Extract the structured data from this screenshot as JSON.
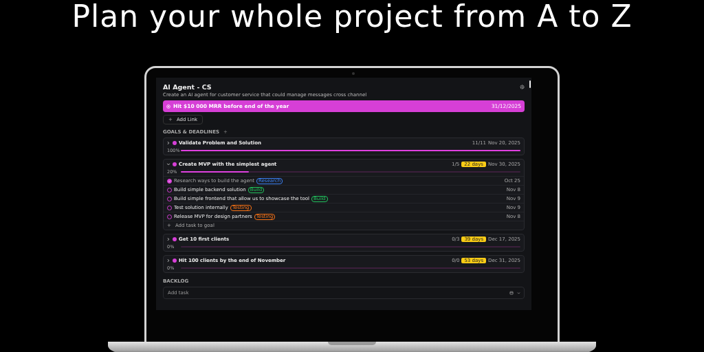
{
  "headline": "Plan your whole project from A to Z",
  "project": {
    "title": "AI Agent - CS",
    "description": "Create an AI agent for customer service that could manage messages cross channel"
  },
  "main_goal": {
    "title": "Hit $10 000 MRR before end of the year",
    "date": "31/12/2025"
  },
  "add_link": {
    "icon": "+",
    "label": "Add Link"
  },
  "goals_section": {
    "title": "GOALS & DEADLINES",
    "add_icon": "+"
  },
  "goals": [
    {
      "title": "Validate Problem and Solution",
      "expanded": false,
      "percent": "100%",
      "level": 1,
      "count": "11/11",
      "date": "Nov 20, 2025"
    },
    {
      "title": "Create MVP with the simplest agent",
      "expanded": true,
      "percent": "20%",
      "level": 0.2,
      "count": "1/5",
      "badge": "22 days",
      "date": "Nov 30, 2025",
      "tasks": [
        {
          "title": "Research ways to build the agent",
          "done": true,
          "tag": {
            "label": "Research",
            "color": "#3b82f6"
          },
          "date": "Oct 25"
        },
        {
          "title": "Build simple backend solution",
          "done": false,
          "tag": {
            "label": "Build",
            "color": "#22c55e"
          },
          "date": "Nov 8"
        },
        {
          "title": "Build simple frontend that allow us to showcase the tool",
          "done": false,
          "tag": {
            "label": "Build",
            "color": "#22c55e"
          },
          "date": "Nov 9"
        },
        {
          "title": "Test solution internally",
          "done": false,
          "tag": {
            "label": "Testing",
            "color": "#f97316"
          },
          "date": "Nov 9"
        },
        {
          "title": "Release MVP for design partners",
          "done": false,
          "tag": {
            "label": "Testing",
            "color": "#f97316"
          },
          "date": "Nov 8"
        }
      ],
      "add_task": {
        "icon": "+",
        "label": "Add task to goal"
      }
    },
    {
      "title": "Get 10 first clients",
      "expanded": false,
      "percent": "0%",
      "level": 0,
      "count": "0/3",
      "badge": "39 days",
      "date": "Dec 17, 2025"
    },
    {
      "title": "Hit 100 clients by the end of November",
      "expanded": false,
      "percent": "0%",
      "level": 0,
      "count": "0/0",
      "badge": "53 days",
      "date": "Dec 31, 2025"
    }
  ],
  "backlog": {
    "title": "BACKLOG",
    "placeholder": "Add task"
  }
}
